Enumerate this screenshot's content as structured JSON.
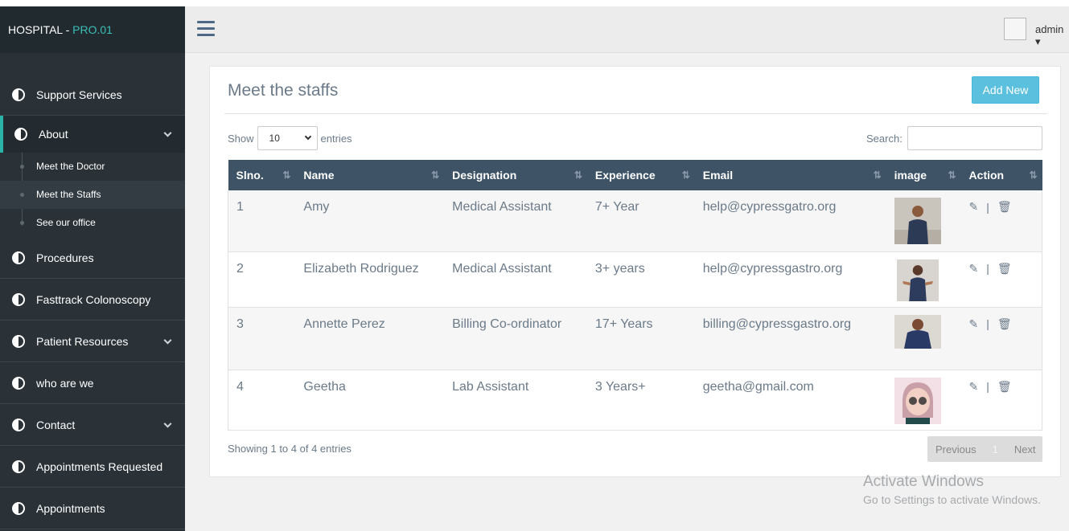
{
  "brand": {
    "name": "HOSPITAL - ",
    "suffix": "PRO.01"
  },
  "sidebar": {
    "items": [
      {
        "label": "Support Services"
      },
      {
        "label": "About",
        "sub": [
          "Meet the Doctor",
          "Meet the Staffs",
          "See our office"
        ]
      },
      {
        "label": "Procedures"
      },
      {
        "label": "Fasttrack Colonoscopy"
      },
      {
        "label": "Patient Resources"
      },
      {
        "label": "who are we"
      },
      {
        "label": "Contact"
      },
      {
        "label": "Appointments Requested"
      },
      {
        "label": "Appointments"
      }
    ]
  },
  "topbar": {
    "user": "admin"
  },
  "page": {
    "title": "Meet the staffs",
    "add_label": "Add New"
  },
  "controls": {
    "show_label": "Show",
    "entries_value": "10",
    "entries_label": "entries",
    "search_label": "Search:"
  },
  "table": {
    "headers": [
      "Slno.",
      "Name",
      "Designation",
      "Experience",
      "Email",
      "image",
      "Action"
    ],
    "rows": [
      {
        "no": "1",
        "name": "Amy",
        "designation": "Medical Assistant",
        "experience": "7+ Year",
        "email": "help@cypressgatro.org"
      },
      {
        "no": "2",
        "name": "Elizabeth Rodriguez",
        "designation": "Medical Assistant",
        "experience": "3+ years",
        "email": "help@cypressgastro.org"
      },
      {
        "no": "3",
        "name": "Annette Perez",
        "designation": "Billing Co-ordinator",
        "experience": "17+ Years",
        "email": "billing@cypressgastro.org"
      },
      {
        "no": "4",
        "name": "Geetha",
        "designation": "Lab Assistant",
        "experience": "3 Years+",
        "email": "geetha@gmail.com"
      }
    ],
    "action_sep": "|"
  },
  "footer": {
    "info": "Showing 1 to 4 of 4 entries",
    "prev": "Previous",
    "page": "1",
    "next": "Next"
  },
  "watermark": {
    "line1": "Activate Windows",
    "line2": "Go to Settings to activate Windows."
  },
  "colors": {
    "sidebar": "#2a3238",
    "header": "#3e5366",
    "accent": "#5bc0de",
    "active": "#2bb3a8"
  }
}
